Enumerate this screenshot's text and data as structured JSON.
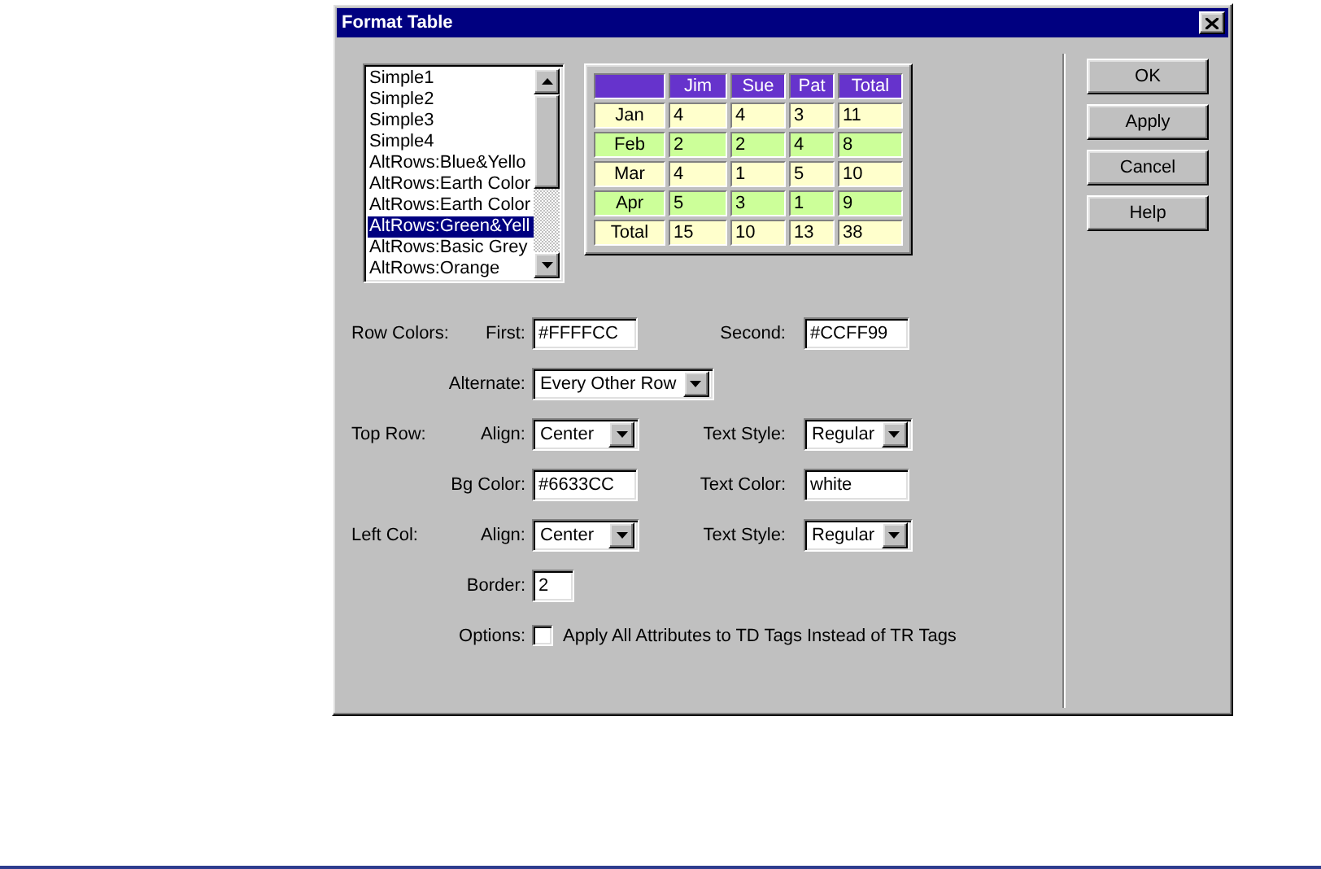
{
  "window": {
    "title": "Format Table"
  },
  "style_list": {
    "items": [
      {
        "label": "Simple1",
        "selected": false
      },
      {
        "label": "Simple2",
        "selected": false
      },
      {
        "label": "Simple3",
        "selected": false
      },
      {
        "label": "Simple4",
        "selected": false
      },
      {
        "label": "AltRows:Blue&Yello",
        "selected": false
      },
      {
        "label": "AltRows:Earth Color",
        "selected": false
      },
      {
        "label": "AltRows:Earth Color",
        "selected": false
      },
      {
        "label": "AltRows:Green&Yell",
        "selected": true
      },
      {
        "label": "AltRows:Basic Grey",
        "selected": false
      },
      {
        "label": "AltRows:Orange",
        "selected": false
      }
    ]
  },
  "preview_table": {
    "header": {
      "color": "#6633cc",
      "cells": [
        "Jim",
        "Sue",
        "Pat",
        "Total"
      ]
    },
    "rows": [
      {
        "label": "Jan",
        "color": "#ffffcc",
        "cells": [
          "4",
          "4",
          "3",
          "11"
        ]
      },
      {
        "label": "Feb",
        "color": "#ccff99",
        "cells": [
          "2",
          "2",
          "4",
          "8"
        ]
      },
      {
        "label": "Mar",
        "color": "#ffffcc",
        "cells": [
          "4",
          "1",
          "5",
          "10"
        ]
      },
      {
        "label": "Apr",
        "color": "#ccff99",
        "cells": [
          "5",
          "3",
          "1",
          "9"
        ]
      },
      {
        "label": "Total",
        "color": "#ffffcc",
        "cells": [
          "15",
          "10",
          "13",
          "38"
        ]
      }
    ]
  },
  "form": {
    "rows": [
      {
        "group": "Row Colors:",
        "fields": [
          {
            "label": "First:",
            "kind": "text",
            "value": "#FFFFCC"
          },
          {
            "label": "Second:",
            "kind": "text",
            "value": "#CCFF99"
          }
        ]
      },
      {
        "fields": [
          {
            "label": "Alternate:",
            "kind": "select",
            "value": "Every Other Row"
          }
        ]
      },
      {
        "group": "Top Row:",
        "fields": [
          {
            "label": "Align:",
            "kind": "select",
            "value": "Center"
          },
          {
            "label": "Text Style:",
            "kind": "select",
            "value": "Regular"
          }
        ]
      },
      {
        "fields": [
          {
            "label": "Bg Color:",
            "kind": "text",
            "value": "#6633CC"
          },
          {
            "label": "Text Color:",
            "kind": "text",
            "value": "white"
          }
        ]
      },
      {
        "group": "Left Col:",
        "fields": [
          {
            "label": "Align:",
            "kind": "select",
            "value": "Center"
          },
          {
            "label": "Text Style:",
            "kind": "select",
            "value": "Regular"
          }
        ]
      },
      {
        "fields": [
          {
            "label": "Border:",
            "kind": "text",
            "value": "2"
          }
        ]
      },
      {
        "fields": [
          {
            "label": "Options:",
            "kind": "checkbox",
            "text": "Apply All Attributes to TD Tags Instead of TR Tags",
            "checked": false
          }
        ]
      }
    ]
  },
  "buttons": [
    "OK",
    "Apply",
    "Cancel",
    "Help"
  ]
}
